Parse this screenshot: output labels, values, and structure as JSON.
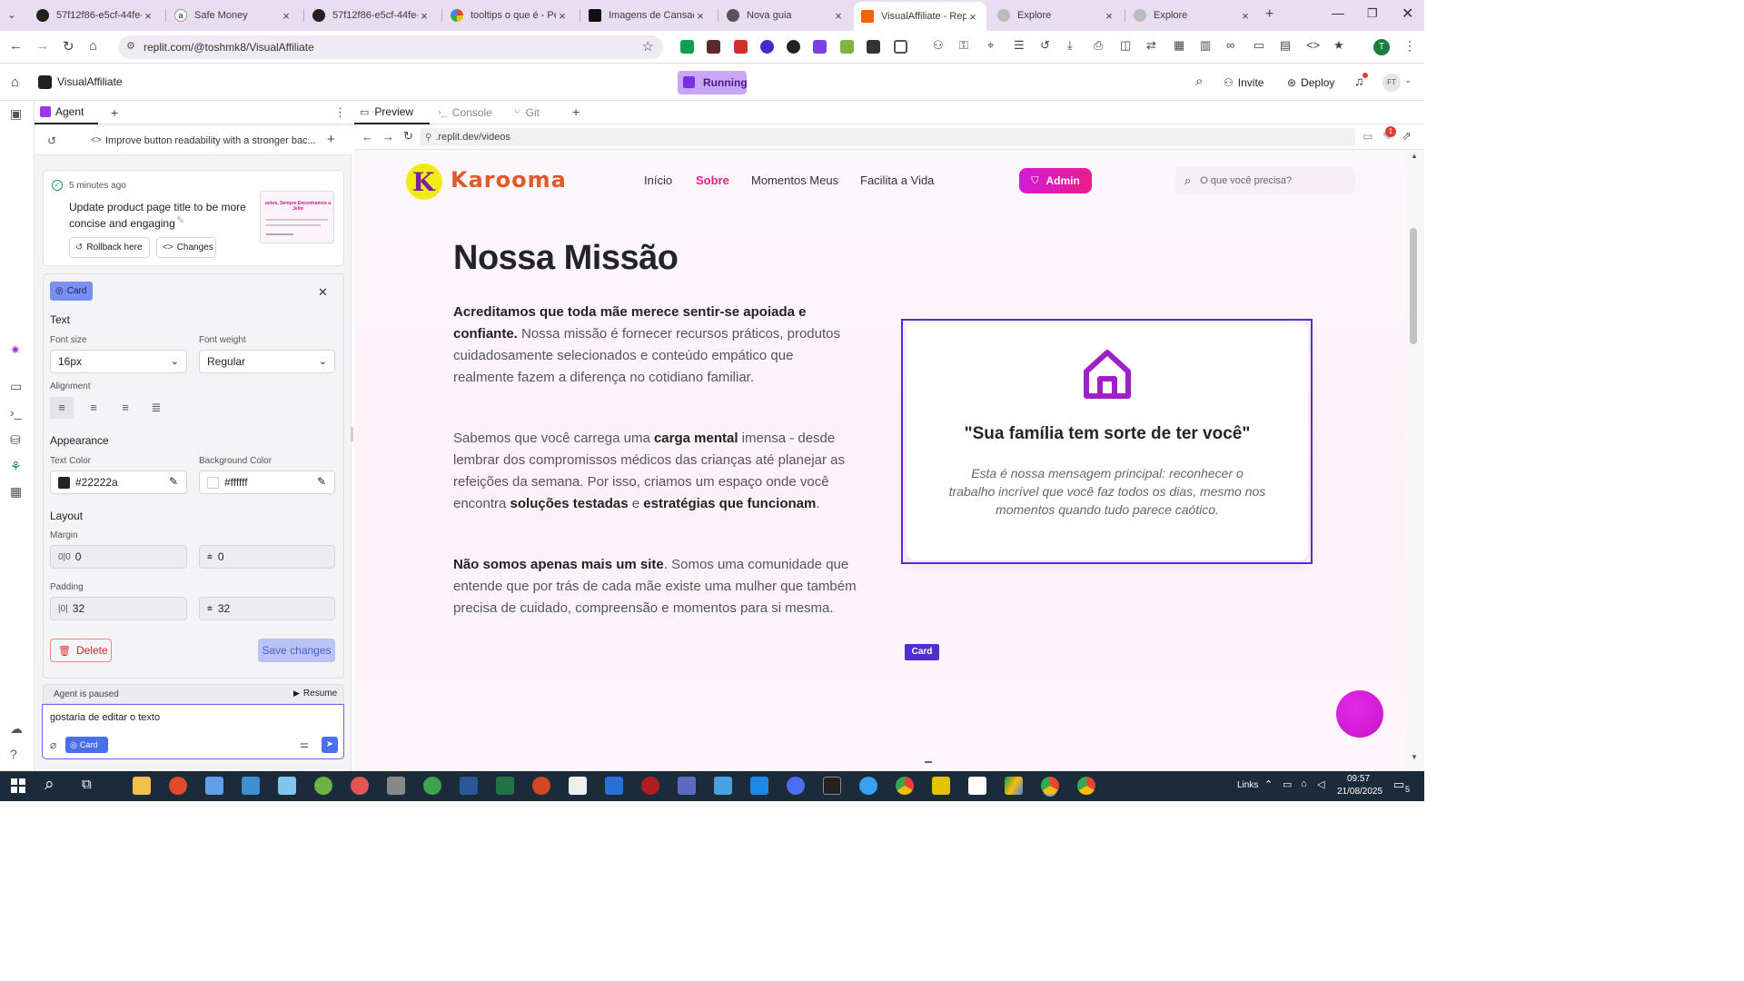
{
  "browser": {
    "tabs": [
      {
        "title": "57f12f86-e5cf-44fe-a",
        "icon": "github-icon"
      },
      {
        "title": "Safe Money",
        "icon": "amazon-icon"
      },
      {
        "title": "57f12f86-e5cf-44fe-a",
        "icon": "github-icon"
      },
      {
        "title": "tooltips o que é - Pes",
        "icon": "google-icon"
      },
      {
        "title": "Imagens de Cansaço",
        "icon": "unsplash-icon"
      },
      {
        "title": "Nova guia",
        "icon": "chrome-icon"
      },
      {
        "title": "VisualAffiliate - Replit",
        "icon": "replit-icon"
      },
      {
        "title": "Explore",
        "icon": "explore-icon"
      },
      {
        "title": "Explore",
        "icon": "explore-icon"
      }
    ],
    "url": "replit.com/@toshmk8/VisualAffiliate",
    "profile_initial": "T"
  },
  "replit": {
    "project_name": "VisualAffiliate",
    "run_status": "Running",
    "invite_label": "Invite",
    "deploy_label": "Deploy",
    "user_initials": "FT",
    "agent_tab": "Agent",
    "checkpoint_title": "Improve button readability with a stronger bac...",
    "history": {
      "time": "5 minutes ago",
      "message": "Update product page title to be more concise and engaging",
      "rollback_label": "Rollback here",
      "changes_label": "Changes",
      "thumb_text": "untos, Sempre Encontramos u Jeito"
    },
    "inspector": {
      "chip_label": "Card",
      "text_section": "Text",
      "font_size_label": "Font size",
      "font_size_value": "16px",
      "font_weight_label": "Font weight",
      "font_weight_value": "Regular",
      "alignment_label": "Alignment",
      "appearance_label": "Appearance",
      "text_color_label": "Text Color",
      "text_color_value": "#22222a",
      "bg_color_label": "Background Color",
      "bg_color_value": "#ffffff",
      "layout_label": "Layout",
      "margin_label": "Margin",
      "margin_x": "0",
      "margin_y": "0",
      "padding_label": "Padding",
      "padding_x": "32",
      "padding_y": "32",
      "delete_label": "Delete",
      "save_label": "Save changes"
    },
    "agent_status": "Agent is paused",
    "resume_label": "Resume",
    "chat_input": "gostaria de editar o texto",
    "chat_chip": "Card"
  },
  "preview": {
    "tabs": [
      "Preview",
      "Console",
      "Git"
    ],
    "url": ".replit.dev/videos",
    "notification_count": "1"
  },
  "site": {
    "logo_text": "Karooma",
    "nav": [
      "Início",
      "Sobre",
      "Momentos Meus",
      "Facilita a Vida"
    ],
    "admin_label": "Admin",
    "search_placeholder": "O que você precisa?",
    "heading": "Nossa Missão",
    "p1_bold": "Acreditamos que toda mãe merece sentir-se apoiada e confiante.",
    "p1_rest": " Nossa missão é fornecer recursos práticos, produtos cuidadosamente selecionados e conteúdo empático que realmente fazem a diferença no cotidiano familiar.",
    "p2_a": "Sabemos que você carrega uma ",
    "p2_b": "carga mental",
    "p2_c": " imensa - desde lembrar dos compromissos médicos das crianças até planejar as refeições da semana. Por isso, criamos um espaço onde você encontra ",
    "p2_d": "soluções testadas",
    "p2_e": " e ",
    "p2_f": "estratégias que funcionam",
    "p2_g": ".",
    "p3_bold": "Não somos apenas mais um site",
    "p3_rest": ". Somos uma comunidade que entende que por trás de cada mãe existe uma mulher que também precisa de cuidado, compreensão e momentos para si mesma.",
    "card_title": "\"Sua família tem sorte de ter você\"",
    "card_text": "Esta é nossa mensagem principal: reconhecer o trabalho incrível que você faz todos os dias, mesmo nos momentos quando tudo parece caótico.",
    "card_tag": "Card"
  },
  "taskbar": {
    "links_label": "Links",
    "time": "09:57",
    "date": "21/08/2025",
    "notif_count": "5"
  },
  "colors": {
    "brand_pink": "#e91e8c",
    "brand_purple": "#a020c8",
    "selection": "#4f2fd0",
    "replit_orange": "#f26207"
  }
}
